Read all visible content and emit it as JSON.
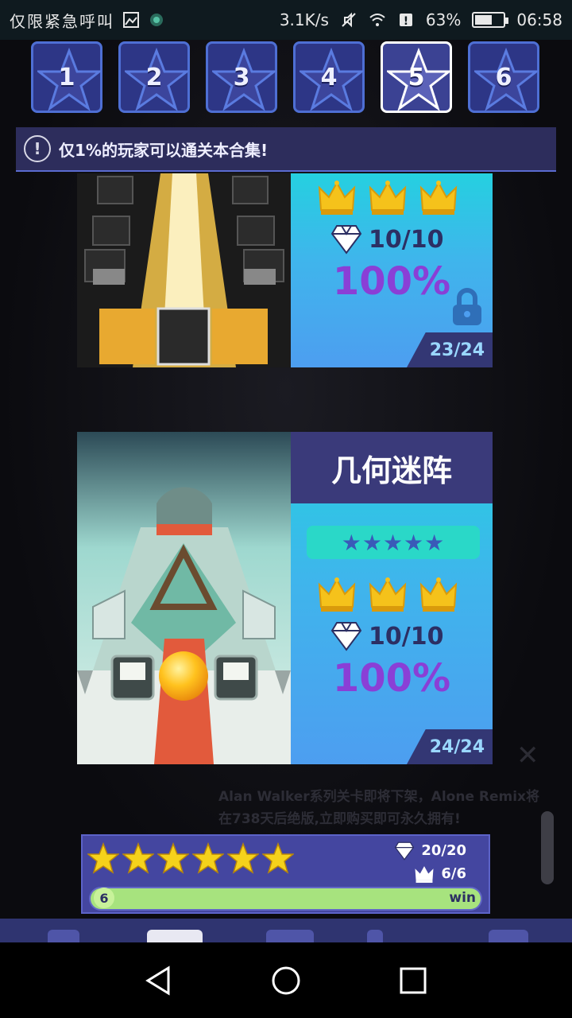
{
  "status_bar": {
    "carrier": "仅限紧急呼叫",
    "speed": "3.1K/s",
    "battery": "63%",
    "battery_level": 0.63,
    "time": "06:58"
  },
  "tiers": [
    {
      "label": "1",
      "active": false
    },
    {
      "label": "2",
      "active": false
    },
    {
      "label": "3",
      "active": false
    },
    {
      "label": "4",
      "active": false
    },
    {
      "label": "5",
      "active": true
    },
    {
      "label": "6",
      "active": false
    }
  ],
  "notice": {
    "text": "仅1%的玩家可以通关本合集!"
  },
  "levels": [
    {
      "gems": "10/10",
      "percent": "100%",
      "count": "23/24",
      "locked": true
    },
    {
      "title": "几何迷阵",
      "difficulty": "★★★★★",
      "gems": "10/10",
      "percent": "100%",
      "count": "24/24"
    }
  ],
  "background_ad": {
    "text": "Alan Walker系列关卡即将下架，Alone Remix将在738天后绝版,立即购买即可永久拥有!",
    "close": "✕"
  },
  "progress": {
    "stars": 6,
    "gems": "20/20",
    "crowns": "6/6",
    "level": "6",
    "win_label": "win",
    "fill": 1.0
  },
  "colors": {
    "accent_blue": "#4e6fd4",
    "panel_purple": "#3a3a7a",
    "percent_purple": "#8a3fd6",
    "crown_gold": "#f5c21b"
  }
}
